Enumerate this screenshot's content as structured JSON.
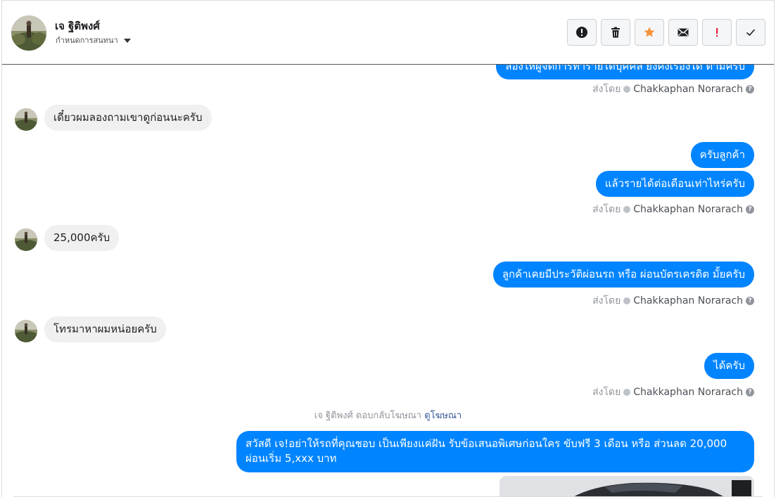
{
  "header": {
    "contact_name": "เจ ฐิติพงศ์",
    "sub_label": "กำหนดการสนทนา"
  },
  "actions": [
    {
      "name": "spam-button",
      "icon": "exclamation-circle-icon"
    },
    {
      "name": "delete-button",
      "icon": "trash-icon"
    },
    {
      "name": "star-button",
      "icon": "star-icon"
    },
    {
      "name": "mark-unread-button",
      "icon": "envelope-icon"
    },
    {
      "name": "follow-up-button",
      "icon": "exclamation-icon"
    },
    {
      "name": "mark-done-button",
      "icon": "check-icon"
    }
  ],
  "colors": {
    "outgoing_bubble": "#0084ff",
    "incoming_bubble": "#f1f0f0",
    "star": "#f7923a",
    "flag": "#e41e3f"
  },
  "messages": {
    "m0": "ลองให้ผู้จัดการทำรายได้บุคคล ยังคงเรื่องได้ ตามครับ",
    "m1": "เดี๋ยวผมลองถามเขาดูก่อนนะครับ",
    "m2": "ครับลูกค้า",
    "m3": "แล้วรายได้ต่อเดือนเท่าไหร่ครับ",
    "m4": "25,000ครับ",
    "m5": "ลูกค้าเคยมีประวัติผ่อนรถ หรือ ผ่อนบัตรเครดิต มั้ยครับ",
    "m6": "โทรมาหาผมหน่อยครับ",
    "m7": "ได้ครับ",
    "m8": "สวัสดี เจ!อย่าให้รถที่คุณชอบ เป็นเพียงแค่ฝัน รับข้อเสนอพิเศษก่อนใคร ขับฟรี 3 เดือน หรือ ส่วนลด 20,000 ผ่อนเริ่ม 5,xxx บาท"
  },
  "sent_by": {
    "prefix": "ส่งโดย",
    "agent": "Chakkaphan Norarach"
  },
  "ad_reply": {
    "text": "เจ ฐิติพงศ์ ตอบกลับโฆษณา",
    "link": "ดูโฆษณา"
  }
}
